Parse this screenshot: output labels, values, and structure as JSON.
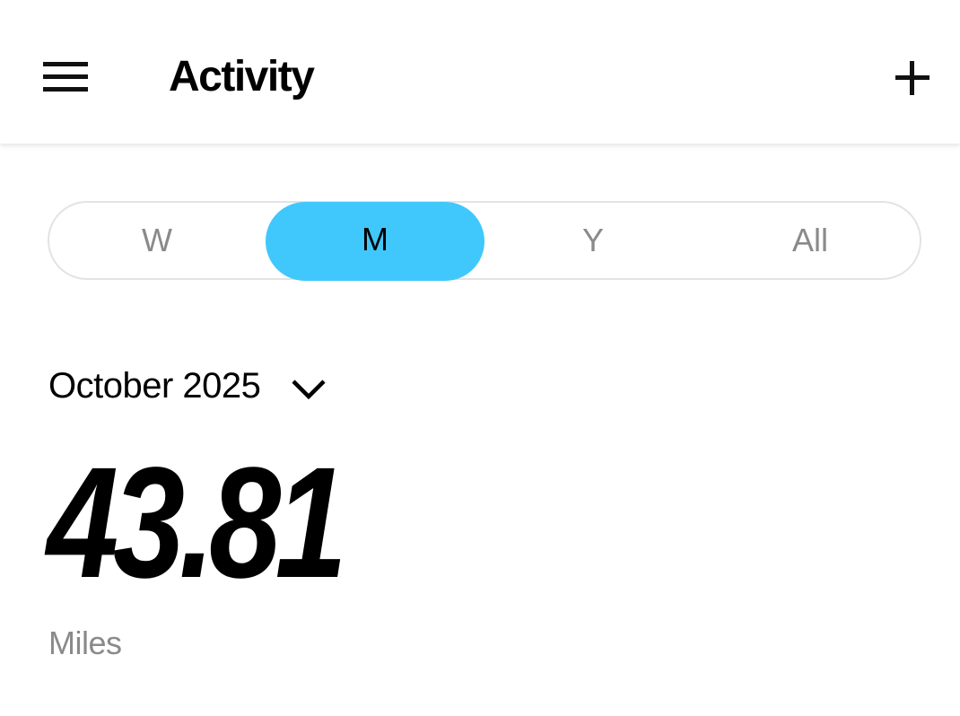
{
  "header": {
    "title": "Activity",
    "menu_icon": "hamburger-menu-icon",
    "add_icon": "plus-icon"
  },
  "range_tabs": {
    "items": [
      {
        "label": "W",
        "selected": false
      },
      {
        "label": "M",
        "selected": true
      },
      {
        "label": "Y",
        "selected": false
      },
      {
        "label": "All",
        "selected": false
      }
    ],
    "accent_color": "#40c8fc"
  },
  "period": {
    "label": "October 2025",
    "icon": "chevron-down-icon"
  },
  "summary": {
    "value": "43.81",
    "unit": "Miles"
  }
}
